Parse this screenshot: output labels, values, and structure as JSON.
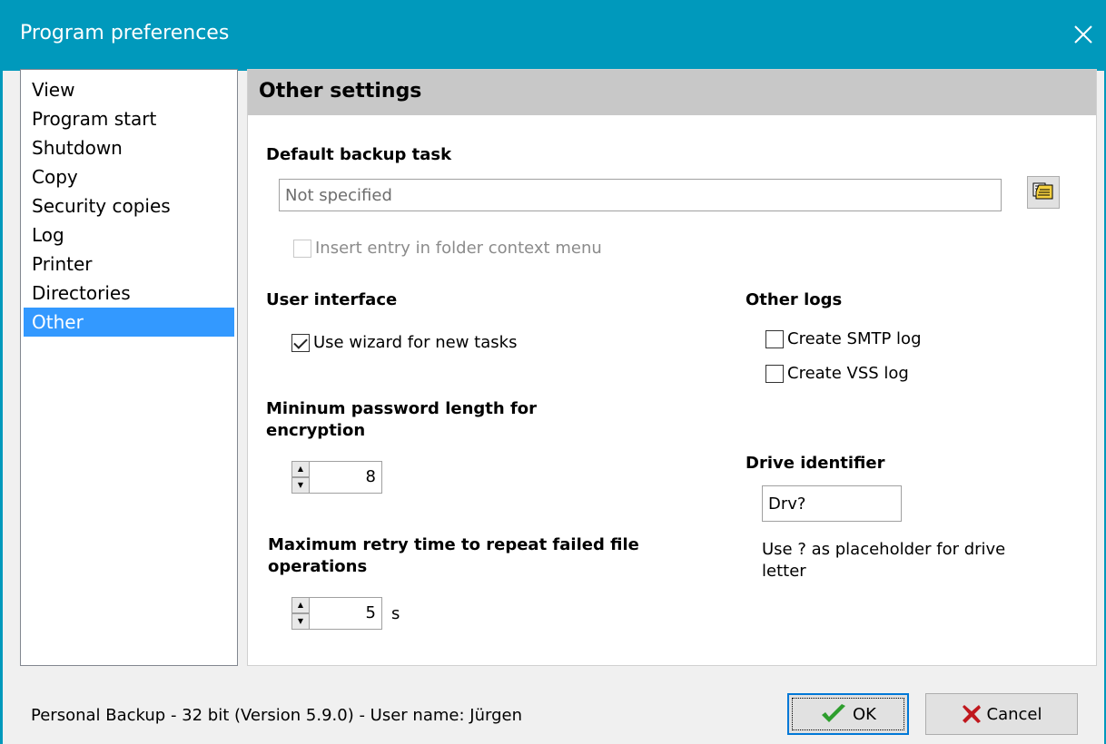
{
  "window": {
    "title": "Program preferences"
  },
  "nav": {
    "items": [
      {
        "label": "View"
      },
      {
        "label": "Program start"
      },
      {
        "label": "Shutdown"
      },
      {
        "label": "Copy"
      },
      {
        "label": "Security copies"
      },
      {
        "label": "Log"
      },
      {
        "label": "Printer"
      },
      {
        "label": "Directories"
      },
      {
        "label": "Other",
        "selected": true
      }
    ]
  },
  "panel": {
    "header": "Other settings",
    "default_backup": {
      "title": "Default backup task",
      "value": "Not specified",
      "browse_icon": "folder-open-icon",
      "context_menu_label": "Insert entry in folder context menu",
      "context_menu_checked": false
    },
    "user_interface": {
      "title": "User interface",
      "wizard_label": "Use wizard for new tasks",
      "wizard_checked": true
    },
    "password": {
      "title_line1": "Mininum password length for",
      "title_line2": "encryption",
      "value": "8"
    },
    "retry": {
      "title_line1": "Maximum retry time to repeat failed file",
      "title_line2": "operations",
      "value": "5",
      "unit": "s"
    },
    "other_logs": {
      "title": "Other logs",
      "smtp_label": "Create SMTP log",
      "smtp_checked": false,
      "vss_label": "Create VSS log",
      "vss_checked": false
    },
    "drive": {
      "title": "Drive identifier",
      "value": "Drv?",
      "help_line1": "Use ? as placeholder for drive",
      "help_line2": "letter"
    }
  },
  "footer": {
    "status": "Personal Backup - 32 bit (Version 5.9.0) - User name: Jürgen",
    "ok_label": "OK",
    "cancel_label": "Cancel"
  },
  "colors": {
    "titlebar": "#0099bc",
    "selection": "#3399ff",
    "header_bg": "#c8c8c8",
    "ok_check": "#2e9e2e",
    "cancel_x": "#c0171d"
  }
}
